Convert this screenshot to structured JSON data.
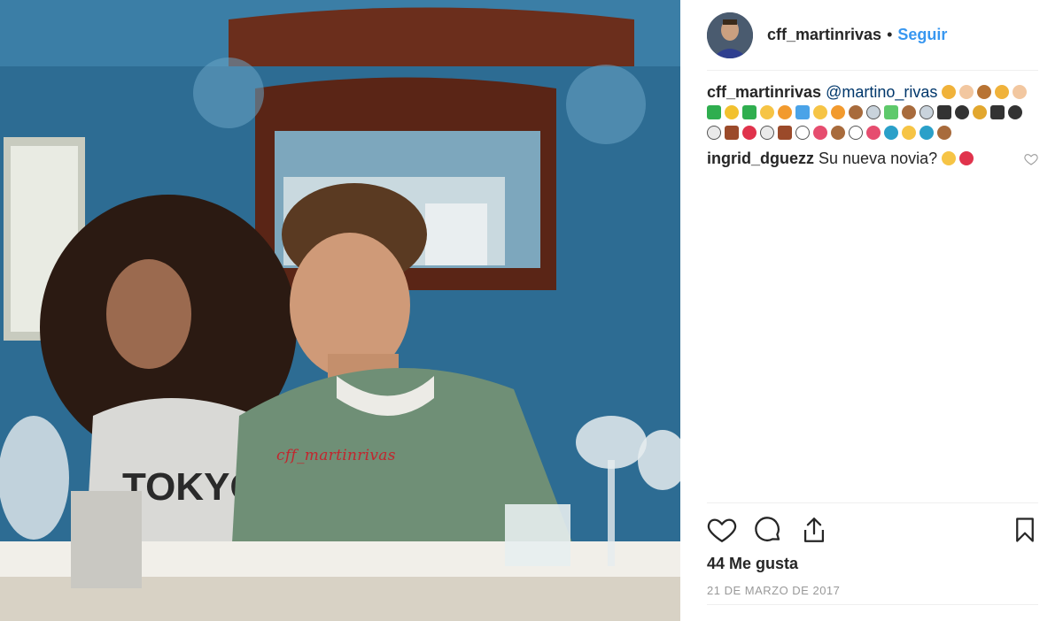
{
  "post": {
    "username": "cff_martinrivas",
    "follow_label": "Seguir",
    "separator": "•",
    "watermark": "cff_martinrivas",
    "caption": {
      "username": "cff_martinrivas",
      "mention": "@martino_rivas",
      "emojis": [
        "cat-face",
        "hamster",
        "squirrel",
        "cat-face",
        "hamster",
        "check-mark",
        "crown",
        "check-mark",
        "victory-hand",
        "tiger-face",
        "gem",
        "victory-hand",
        "tiger-face",
        "monkey-face",
        "ring",
        "pistol",
        "monkey-face",
        "ring",
        "end-arrow",
        "paw-prints",
        "trident",
        "end-arrow",
        "paw-prints",
        "ghost",
        "chocolate",
        "kiss-mark",
        "ghost",
        "chocolate",
        "eyes",
        "tongue",
        "see-no-evil-monkey",
        "eyes",
        "tongue",
        "surfer",
        "fist",
        "surfer",
        "see-no-evil-monkey"
      ]
    },
    "comments": [
      {
        "username": "ingrid_dguezz",
        "text": "Su nueva novia?",
        "emojis": [
          "sad-face",
          "broken-heart"
        ]
      }
    ],
    "likes_text": "44 Me gusta",
    "date": "21 DE MARZO DE 2017"
  },
  "icons": {
    "like": "heart-outline-icon",
    "comment": "comment-bubble-icon",
    "share": "share-upload-icon",
    "save": "bookmark-icon",
    "comment_like": "small-heart-icon"
  },
  "colors": {
    "follow_blue": "#3897f0",
    "text": "#262626",
    "muted": "#999999",
    "watermark_red": "#c2262e"
  }
}
